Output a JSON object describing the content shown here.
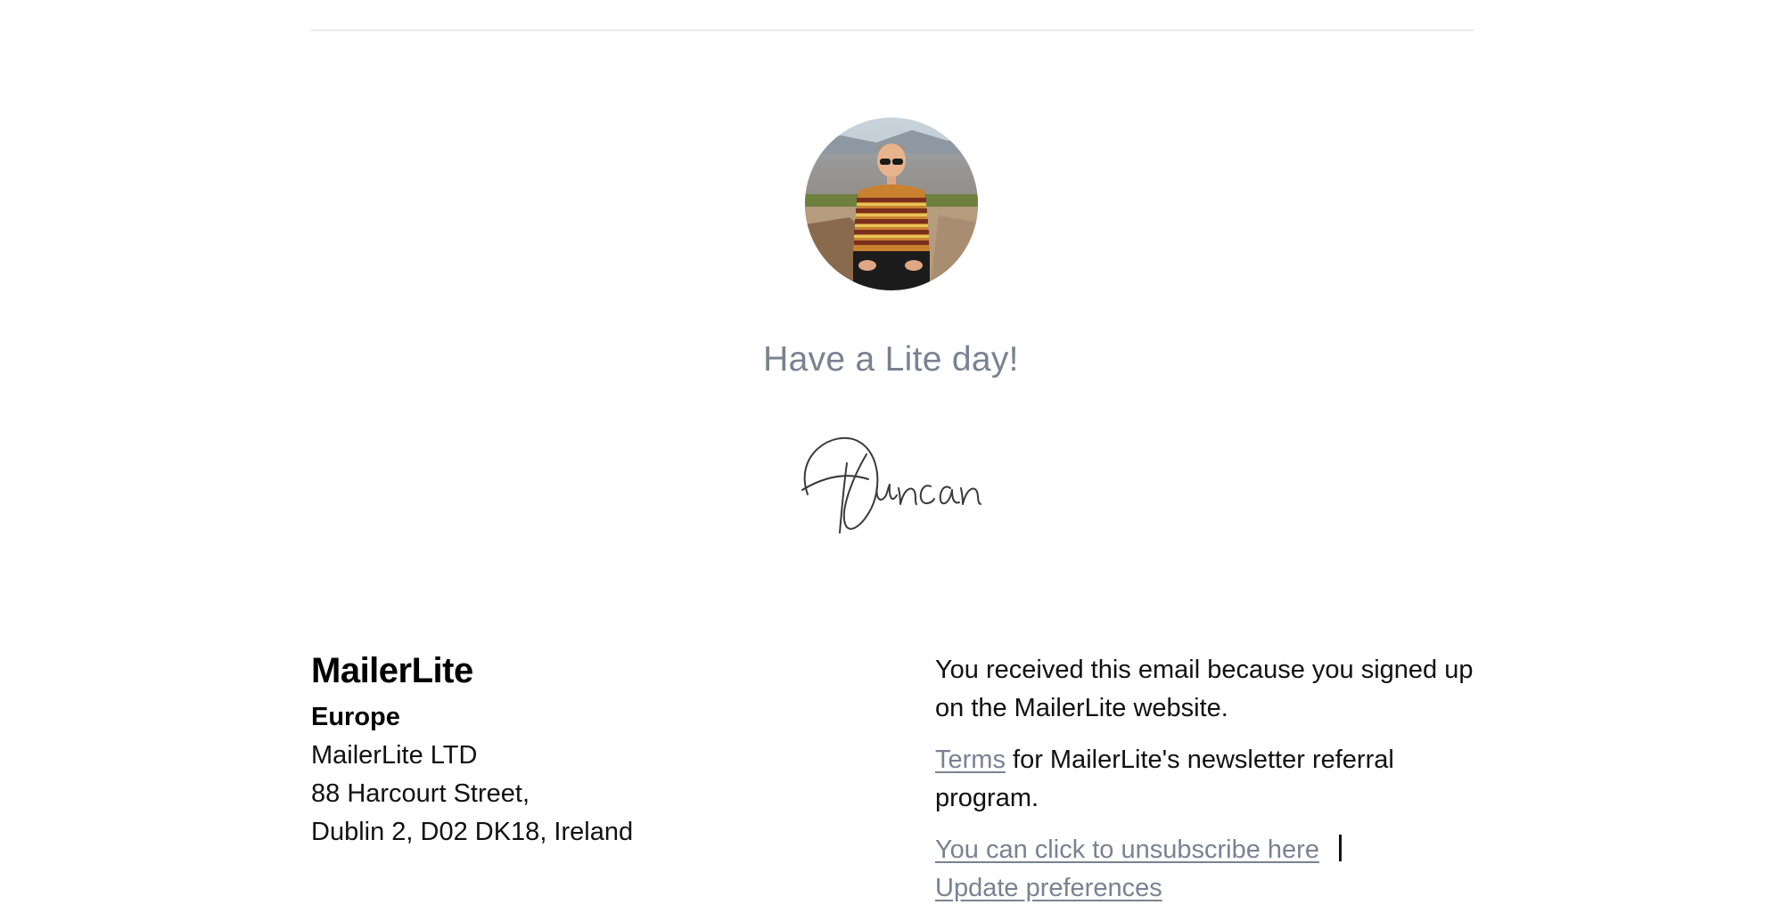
{
  "greeting": "Have a Lite day!",
  "signature": {
    "name": "Duncan",
    "style": "handwritten-script"
  },
  "avatar": {
    "description_icon": "person-photo-avatar"
  },
  "footer": {
    "brand": "MailerLite",
    "region": "Europe",
    "address_lines": [
      "MailerLite LTD",
      "88 Harcourt Street,",
      "Dublin 2, D02 DK18, Ireland"
    ],
    "reason": "You received this email because you signed up on the MailerLite website.",
    "terms_link": "Terms",
    "terms_suffix": " for MailerLite's newsletter referral program.",
    "unsubscribe_link": "You can click to unsubscribe here",
    "preferences_link": "Update preferences"
  },
  "colors": {
    "muted_text": "#7a8291",
    "divider": "#e9ebee",
    "body_text": "#111111"
  }
}
